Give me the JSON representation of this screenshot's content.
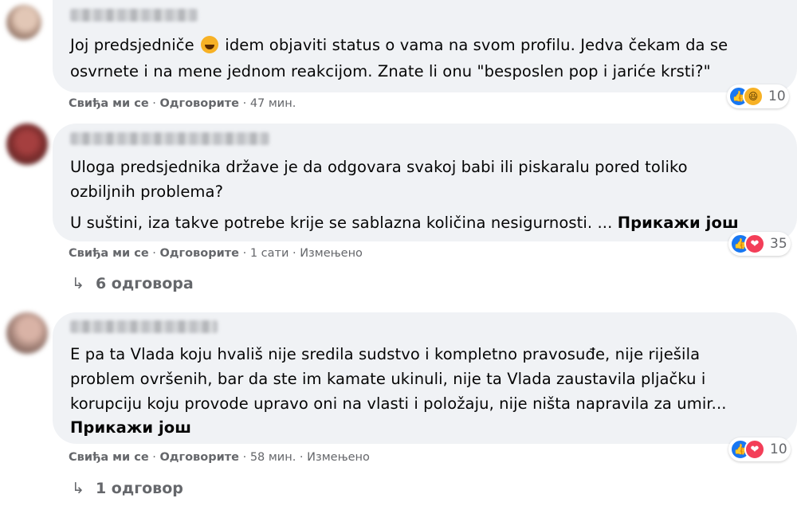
{
  "comments": [
    {
      "text_lines": [
        [
          "Joj predsjedniče ",
          " idem objaviti status o vama na svom profilu. Jedva čekam da se"
        ],
        "osvrnete i na mene jednom reakcijom. Znate li onu \"besposlen pop i jariće krsti?\""
      ],
      "inline_emoji": "rolling-laughing-emoji",
      "like_label": "Свиђа ми се",
      "reply_label": "Одговорите",
      "time": "47 мин.",
      "reactions": [
        "like",
        "haha"
      ],
      "reaction_count": "10"
    },
    {
      "text_lines": [
        "Uloga predsjednika države je da odgovara svakoj babi ili piskaralu pored toliko",
        "ozbiljnih problema?",
        "U suštini, iza takve potrebe krije se sablazna količina nesigurnosti. ..."
      ],
      "see_more": "Прикажи још",
      "like_label": "Свиђа ми се",
      "reply_label": "Одговорите",
      "time": "1 сати",
      "edited": "Измењено",
      "reactions": [
        "like",
        "love"
      ],
      "reaction_count": "35",
      "replies_label": "6 одговора"
    },
    {
      "text_lines": [
        "E pa ta Vlada koju hvališ nije sredila sudstvo i kompletno pravosuđe, nije riješila",
        "problem ovršenih, bar da ste im kamate ukinuli, nije ta Vlada zaustavila pljačku i",
        "korupciju koju provode upravo oni na vlasti i položaju, nije ništa napravila za umir..."
      ],
      "see_more": "Прикажи још",
      "like_label": "Свиђа ми се",
      "reply_label": "Одговорите",
      "time": "58 мин.",
      "edited": "Измењено",
      "reactions": [
        "like",
        "love"
      ],
      "reaction_count": "10",
      "replies_label": "1 одговор"
    }
  ],
  "colors": {
    "bubble": "#f0f2f5",
    "secondary_text": "#65676b",
    "like": "#1877f2",
    "love": "#f33e58",
    "haha": "#f7b125"
  },
  "icons": {
    "reply_arrow": "reply-arrow-icon"
  }
}
